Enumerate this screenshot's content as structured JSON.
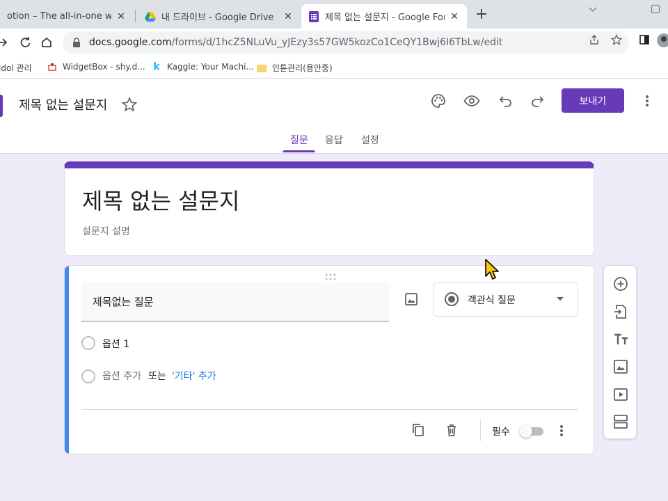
{
  "browser": {
    "tabs": [
      {
        "title": "otion – The all-in-one worksp",
        "close": "✕"
      },
      {
        "title": "내 드라이브 - Google Drive",
        "close": "✕"
      },
      {
        "title": "제목 없는 설문지 - Google For",
        "close": "✕"
      }
    ],
    "new_tab": "+",
    "url_host": "docs.google.com",
    "url_path": "/forms/d/1hcZ5NLuVu_yJEzy3s57GW5kozCo1CeQY1Bwj6I6TbLw/edit",
    "bookmarks": [
      {
        "label": "ldol 관리"
      },
      {
        "label": "WidgetBox - shy.d..."
      },
      {
        "label": "Kaggle: Your Machi..."
      },
      {
        "label": "인튠관리(용안중)"
      }
    ]
  },
  "header": {
    "form_name": "제목 없는 설문지",
    "send_label": "보내기",
    "tabs": [
      {
        "label": "질문",
        "active": true
      },
      {
        "label": "응답",
        "active": false
      },
      {
        "label": "설정",
        "active": false
      }
    ]
  },
  "title_card": {
    "title": "제목 없는 설문지",
    "description": "설문지 설명"
  },
  "question": {
    "text": "제목없는 질문",
    "type_label": "객관식 질문",
    "options": [
      {
        "label": "옵션 1"
      }
    ],
    "add_option": "옵션 추가",
    "or_text": "또는",
    "add_other": "'기타' 추가",
    "required_label": "필수",
    "required": false
  },
  "colors": {
    "accent": "#673ab7",
    "background": "#f0ebf8",
    "question_accent": "#4285f4",
    "link": "#1a73e8"
  },
  "icons": [
    "palette-icon",
    "preview-eye-icon",
    "undo-icon",
    "redo-icon",
    "more-vert-icon",
    "star-icon",
    "image-icon",
    "radio-icon",
    "copy-icon",
    "delete-icon",
    "add-question-icon",
    "import-questions-icon",
    "add-title-icon",
    "add-image-icon",
    "add-video-icon",
    "add-section-icon"
  ]
}
